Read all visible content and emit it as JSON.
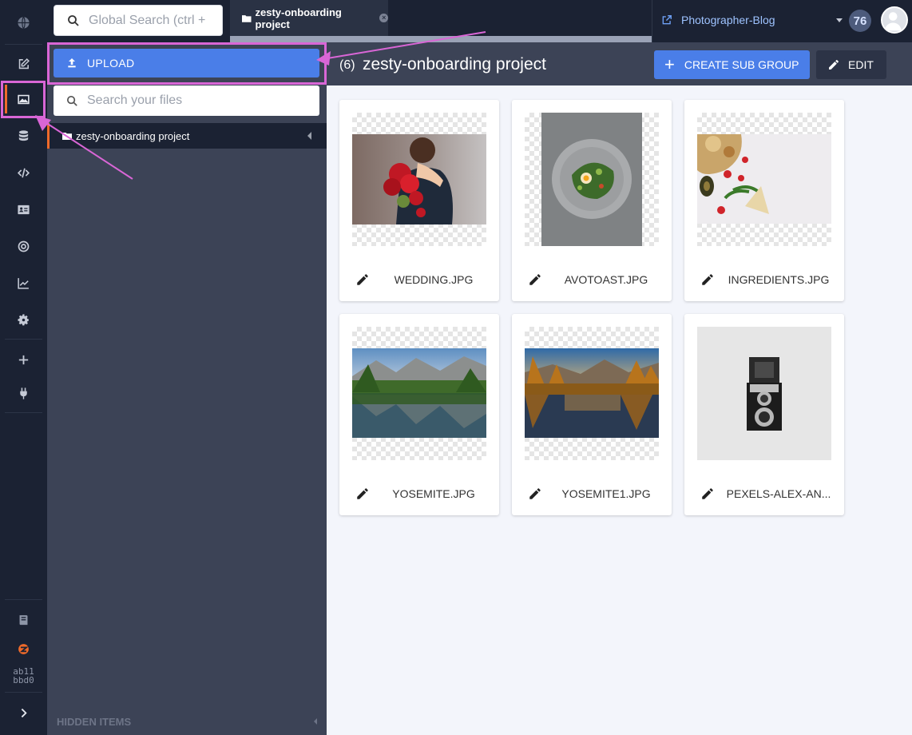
{
  "colors": {
    "accent": "#4a7ee8",
    "sidebar": "#1b2233",
    "panel": "#3c4356",
    "active": "#ef6a2a",
    "annotation": "#d966d6"
  },
  "rail": {
    "icons": [
      "globe-icon",
      "edit-content-icon",
      "media-icon",
      "database-icon",
      "code-icon",
      "leads-icon",
      "seo-target-icon",
      "analytics-icon",
      "settings-icon",
      "add-icon",
      "plugin-icon",
      "docs-icon",
      "zesty-logo-icon",
      "expand-icon"
    ],
    "hash_line1": "ab11",
    "hash_line2": "bbd0"
  },
  "global_search": {
    "placeholder": "Global Search (ctrl + k)"
  },
  "tab": {
    "label": "zesty-onboarding project"
  },
  "site": {
    "name": "Photographer-Blog",
    "badge": "76"
  },
  "panel": {
    "upload_label": "UPLOAD",
    "file_search_placeholder": "Search your files",
    "tree_item": "zesty-onboarding project",
    "hidden_items": "HIDDEN ITEMS"
  },
  "header": {
    "count": "(6)",
    "title": "zesty-onboarding project",
    "create_sub_group": "CREATE SUB GROUP",
    "edit": "EDIT"
  },
  "files": [
    {
      "name": "WEDDING.JPG",
      "image": "wedding"
    },
    {
      "name": "AVOTOAST.JPG",
      "image": "avotoast"
    },
    {
      "name": "INGREDIENTS.JPG",
      "image": "ingredients"
    },
    {
      "name": "YOSEMITE.JPG",
      "image": "yosemite"
    },
    {
      "name": "YOSEMITE1.JPG",
      "image": "yosemite-autumn"
    },
    {
      "name": "PEXELS-ALEX-AN...",
      "image": "camera"
    }
  ]
}
